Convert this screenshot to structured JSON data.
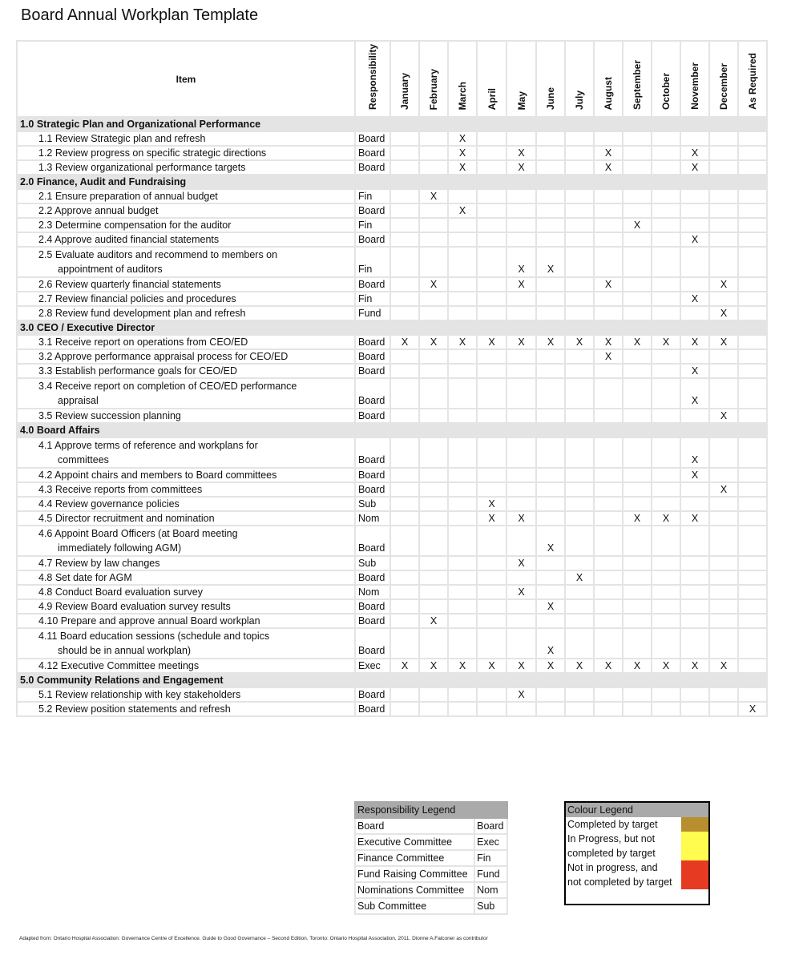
{
  "title": "Board Annual Workplan Template",
  "table": {
    "headers": {
      "item": "Item",
      "responsibility": "Responsibility",
      "months": [
        "January",
        "February",
        "March",
        "April",
        "May",
        "June",
        "July",
        "August",
        "September",
        "October",
        "November",
        "December",
        "As Required"
      ]
    },
    "mark_symbol": "X",
    "sections": [
      {
        "title": "1.0 Strategic Plan and Organizational Performance",
        "rows": [
          {
            "item": "1.1 Review Strategic plan and refresh",
            "resp": "Board",
            "marks": [
              "March"
            ]
          },
          {
            "item": "1.2 Review progress on specific strategic directions",
            "resp": "Board",
            "marks": [
              "March",
              "May",
              "August",
              "November"
            ]
          },
          {
            "item": "1.3 Review organizational performance targets",
            "resp": "Board",
            "marks": [
              "March",
              "May",
              "August",
              "November"
            ]
          }
        ]
      },
      {
        "title": "2.0 Finance, Audit and Fundraising",
        "rows": [
          {
            "item": "2.1 Ensure preparation of annual budget",
            "resp": "Fin",
            "marks": [
              "February"
            ]
          },
          {
            "item": "2.2 Approve annual budget",
            "resp": "Board",
            "marks": [
              "March"
            ]
          },
          {
            "item": "2.3 Determine compensation for the auditor",
            "resp": "Fin",
            "marks": [
              "September"
            ]
          },
          {
            "item": "2.4 Approve audited financial statements",
            "resp": "Board",
            "marks": [
              "November"
            ]
          },
          {
            "item": "2.5 Evaluate auditors and recommend to members on",
            "item_line2": "appointment of auditors",
            "resp": "Fin",
            "marks": [
              "May",
              "June"
            ]
          },
          {
            "item": "2.6 Review quarterly financial statements",
            "resp": "Board",
            "marks": [
              "February",
              "May",
              "August",
              "December"
            ]
          },
          {
            "item": "2.7 Review financial policies and procedures",
            "resp": "Fin",
            "marks": [
              "November"
            ]
          },
          {
            "item": "2.8 Review fund development plan and refresh",
            "resp": "Fund",
            "marks": [
              "December"
            ]
          }
        ]
      },
      {
        "title": "3.0 CEO / Executive Director",
        "rows": [
          {
            "item": "3.1 Receive report on operations from CEO/ED",
            "resp": "Board",
            "marks": [
              "January",
              "February",
              "March",
              "April",
              "May",
              "June",
              "July",
              "August",
              "September",
              "October",
              "November",
              "December"
            ]
          },
          {
            "item": "3.2 Approve performance appraisal process for CEO/ED",
            "resp": "Board",
            "marks": [
              "August"
            ]
          },
          {
            "item": "3.3 Establish performance goals for CEO/ED",
            "resp": "Board",
            "marks": [
              "November"
            ]
          },
          {
            "item": "3.4 Receive report on completion of CEO/ED performance",
            "item_line2": "appraisal",
            "resp": "Board",
            "marks": [
              "November"
            ]
          },
          {
            "item": "3.5 Review succession planning",
            "resp": "Board",
            "marks": [
              "December"
            ]
          }
        ]
      },
      {
        "title": "4.0 Board Affairs",
        "rows": [
          {
            "item": "4.1 Approve terms of reference and workplans for",
            "item_line2": "committees",
            "resp": "Board",
            "marks": [
              "November"
            ]
          },
          {
            "item": "4.2 Appoint chairs and members to Board committees",
            "resp": "Board",
            "marks": [
              "November"
            ]
          },
          {
            "item": "4.3 Receive reports from committees",
            "resp": "Board",
            "marks": [
              "December"
            ]
          },
          {
            "item": "4.4 Review governance policies",
            "resp": "Sub",
            "marks": [
              "April"
            ]
          },
          {
            "item": "4.5 Director recruitment and nomination",
            "resp": "Nom",
            "marks": [
              "April",
              "May",
              "September",
              "October",
              "November"
            ]
          },
          {
            "item": "4.6 Appoint Board Officers (at Board meeting",
            "item_line2": "immediately following AGM)",
            "resp": "Board",
            "marks": [
              "June"
            ]
          },
          {
            "item": "4.7 Review by law changes",
            "resp": "Sub",
            "marks": [
              "May"
            ]
          },
          {
            "item": "4.8 Set date for AGM",
            "resp": "Board",
            "marks": [
              "July"
            ]
          },
          {
            "item": "4.8 Conduct Board evaluation survey",
            "resp": "Nom",
            "marks": [
              "May"
            ]
          },
          {
            "item": "4.9 Review Board evaluation survey results",
            "resp": "Board",
            "marks": [
              "June"
            ]
          },
          {
            "item": "4.10 Prepare and approve annual Board workplan",
            "resp": "Board",
            "marks": [
              "February"
            ]
          },
          {
            "item": "4.11 Board education sessions (schedule and topics",
            "item_line2": "should be in annual workplan)",
            "resp": "Board",
            "marks": [
              "June"
            ]
          },
          {
            "item": "4.12 Executive Committee meetings",
            "resp": "Exec",
            "marks": [
              "January",
              "February",
              "March",
              "April",
              "May",
              "June",
              "July",
              "August",
              "September",
              "October",
              "November",
              "December"
            ]
          }
        ]
      },
      {
        "title": "5.0 Community Relations and Engagement",
        "rows": [
          {
            "item": "5.1 Review relationship with key stakeholders",
            "resp": "Board",
            "marks": [
              "May"
            ]
          },
          {
            "item": "5.2 Review position statements and refresh",
            "resp": "Board",
            "marks": [
              "As Required"
            ]
          }
        ]
      }
    ]
  },
  "responsibility_legend": {
    "title": "Responsibility Legend",
    "entries": [
      {
        "name": "Board",
        "code": "Board"
      },
      {
        "name": "Executive Committee",
        "code": "Exec"
      },
      {
        "name": "Finance Committee",
        "code": "Fin"
      },
      {
        "name": "Fund Raising Committee",
        "code": "Fund"
      },
      {
        "name": "Nominations Committee",
        "code": "Nom"
      },
      {
        "name": "Sub Committee",
        "code": "Sub"
      }
    ]
  },
  "colour_legend": {
    "title": "Colour Legend",
    "entries": [
      {
        "label_lines": [
          "Completed by target"
        ],
        "color": "#b88f2f"
      },
      {
        "label_lines": [
          "In Progress, but not",
          "completed by target"
        ],
        "color": "#fffb4f"
      },
      {
        "label_lines": [
          "Not in progress, and",
          "not completed by target"
        ],
        "color": "#e63a23"
      }
    ]
  },
  "footer": "Adapted from: Ontario Hospital Association: Governance Centre of Excellence. Guide to Good Governance – Second Edition. Toronto: Ontario Hospital Association, 2011. Dionne A.Falconer as contributor"
}
